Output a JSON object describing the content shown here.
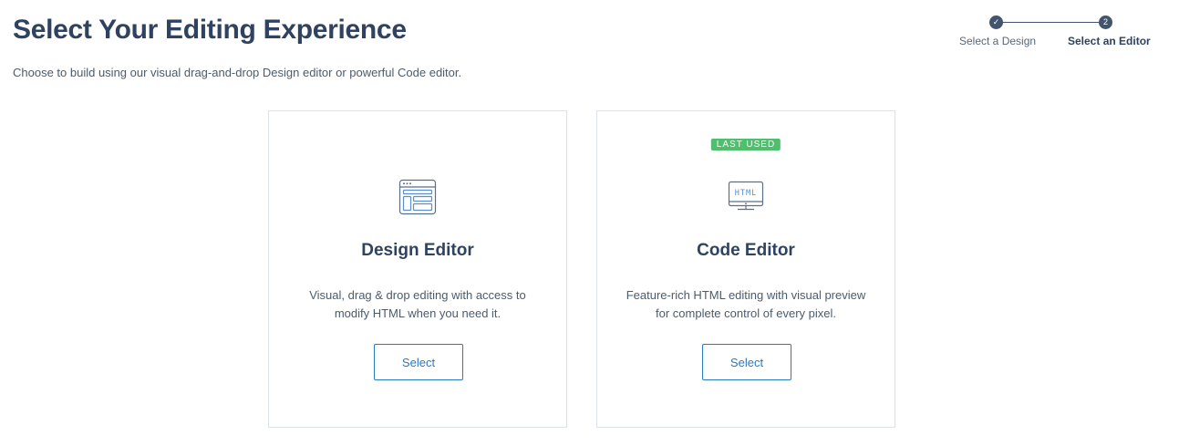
{
  "header": {
    "title": "Select Your Editing Experience",
    "subtitle": "Choose to build using our visual drag-and-drop Design editor or powerful Code editor."
  },
  "stepper": {
    "steps": [
      {
        "label": "Select a Design",
        "marker": "✓",
        "state": "completed"
      },
      {
        "label": "Select an Editor",
        "marker": "2",
        "state": "current"
      }
    ]
  },
  "cards": [
    {
      "title": "Design Editor",
      "description": "Visual, drag & drop editing with access to modify HTML when you need it.",
      "button_label": "Select",
      "icon": "design-layout-icon",
      "badge": ""
    },
    {
      "title": "Code Editor",
      "description": "Feature-rich HTML editing with visual preview for complete control of every pixel.",
      "button_label": "Select",
      "icon": "html-monitor-icon",
      "icon_text": "HTML",
      "badge": "LAST USED"
    }
  ],
  "colors": {
    "heading": "#2f4360",
    "accent_blue": "#2a79c4",
    "badge_green": "#4fbf6e",
    "icon_blue": "#5a8fd0",
    "card_border": "#dde3ea"
  }
}
